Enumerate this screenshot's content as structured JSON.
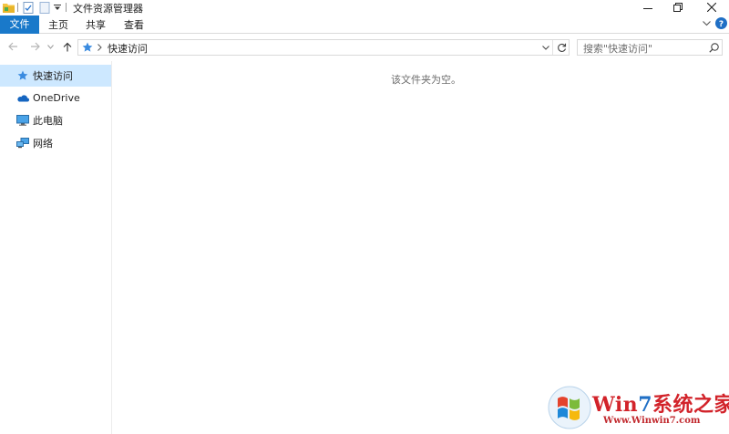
{
  "window": {
    "title": "文件资源管理器"
  },
  "ribbon": {
    "tabs": [
      {
        "label": "文件"
      },
      {
        "label": "主页"
      },
      {
        "label": "共享"
      },
      {
        "label": "查看"
      }
    ]
  },
  "address": {
    "path": "快速访问"
  },
  "search": {
    "placeholder": "搜索\"快速访问\""
  },
  "sidebar": {
    "items": [
      {
        "label": "快速访问",
        "icon": "star-icon",
        "selected": true
      },
      {
        "label": "OneDrive",
        "icon": "cloud-icon",
        "selected": false
      },
      {
        "label": "此电脑",
        "icon": "computer-icon",
        "selected": false
      },
      {
        "label": "网络",
        "icon": "network-icon",
        "selected": false
      }
    ]
  },
  "content": {
    "empty_message": "该文件夹为空。"
  },
  "watermark": {
    "brand": "Win7系统之家",
    "url": "Www.Winwin7.com"
  },
  "colors": {
    "accent": "#1979ca",
    "selection": "#cde8ff",
    "help": "#1f6fc5"
  }
}
